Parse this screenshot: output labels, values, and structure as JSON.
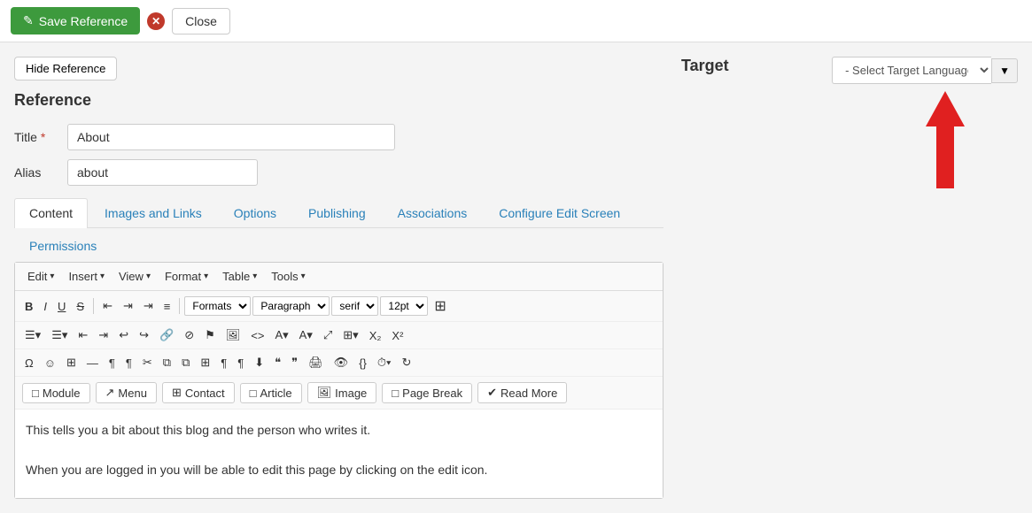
{
  "toolbar": {
    "save_label": "Save Reference",
    "close_label": "Close",
    "save_icon": "✎",
    "close_x": "✕"
  },
  "reference": {
    "hide_btn": "Hide Reference",
    "panel_title": "Reference",
    "title_label": "Title",
    "title_required": "*",
    "title_value": "About",
    "alias_label": "Alias",
    "alias_value": "about"
  },
  "tabs": [
    {
      "id": "content",
      "label": "Content",
      "active": true
    },
    {
      "id": "images-links",
      "label": "Images and Links",
      "active": false
    },
    {
      "id": "options",
      "label": "Options",
      "active": false
    },
    {
      "id": "publishing",
      "label": "Publishing",
      "active": false
    },
    {
      "id": "associations",
      "label": "Associations",
      "active": false
    },
    {
      "id": "configure-edit",
      "label": "Configure Edit Screen",
      "active": false
    },
    {
      "id": "permissions",
      "label": "Permissions",
      "active": false
    }
  ],
  "editor": {
    "menu_items": [
      {
        "id": "edit",
        "label": "Edit"
      },
      {
        "id": "insert",
        "label": "Insert"
      },
      {
        "id": "view",
        "label": "View"
      },
      {
        "id": "format",
        "label": "Format"
      },
      {
        "id": "table",
        "label": "Table"
      },
      {
        "id": "tools",
        "label": "Tools"
      }
    ],
    "toolbar_row1": {
      "bold": "B",
      "italic": "I",
      "underline": "U",
      "strike": "S",
      "align_left": "≡",
      "align_center": "≡",
      "align_right": "≡",
      "align_justify": "≡",
      "formats_select": "Formats",
      "paragraph_select": "Paragraph",
      "font_select": "serif",
      "size_select": "12pt",
      "find_btn": "⊞"
    },
    "toolbar_row2_icons": [
      "≡▼",
      "⊡▼",
      "☰",
      "☰",
      "↩",
      "↪",
      "🔗",
      "⊘",
      "⚑",
      "🖼",
      "<>",
      "A▼",
      "A▼",
      "⤢",
      "⊞▼",
      "X₂",
      "X²"
    ],
    "toolbar_row3_icons": [
      "Ω",
      "☺",
      "⊞",
      "—",
      "¶",
      "¶",
      "✂",
      "⧉",
      "⧉",
      "⊞",
      "¶",
      "¶",
      "⬇",
      "❝",
      "❝",
      "🖨",
      "👁",
      "{}",
      "⏱▼",
      "↻"
    ],
    "insert_buttons": [
      {
        "id": "module",
        "icon": "□",
        "label": "Module"
      },
      {
        "id": "menu",
        "icon": "↗",
        "label": "Menu"
      },
      {
        "id": "contact",
        "icon": "⊞",
        "label": "Contact"
      },
      {
        "id": "article",
        "icon": "□",
        "label": "Article"
      },
      {
        "id": "image",
        "icon": "🖼",
        "label": "Image"
      },
      {
        "id": "page-break",
        "icon": "□",
        "label": "Page Break"
      },
      {
        "id": "read-more",
        "icon": "✔",
        "label": "Read More"
      }
    ],
    "content_lines": [
      "This tells you a bit about this blog and the person who writes it.",
      "When you are logged in you will be able to edit this page by clicking on the edit icon."
    ]
  },
  "target": {
    "title": "Target",
    "lang_select_placeholder": "- Select Target Language -",
    "lang_dropdown_icon": "▼"
  }
}
